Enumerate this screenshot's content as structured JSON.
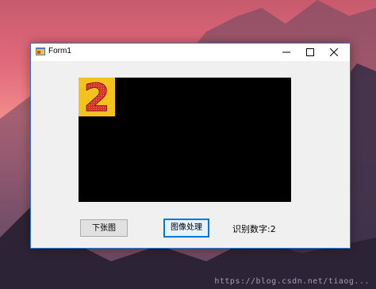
{
  "window": {
    "title": "Form1",
    "controls": {
      "minimize_icon": "minimize-icon",
      "maximize_icon": "maximize-icon",
      "close_icon": "close-icon"
    }
  },
  "picture": {
    "digit": "2",
    "digit_color": "#d8322a",
    "tile_color": "#f4c21d",
    "background": "#000000"
  },
  "buttons": {
    "next_image": "下张图",
    "process_image": "图像处理"
  },
  "result_text": "识别数字:2",
  "watermark": "https://blog.csdn.net/tiaog...",
  "colors": {
    "accent": "#0078d7",
    "window_bg": "#f0f0f0"
  }
}
